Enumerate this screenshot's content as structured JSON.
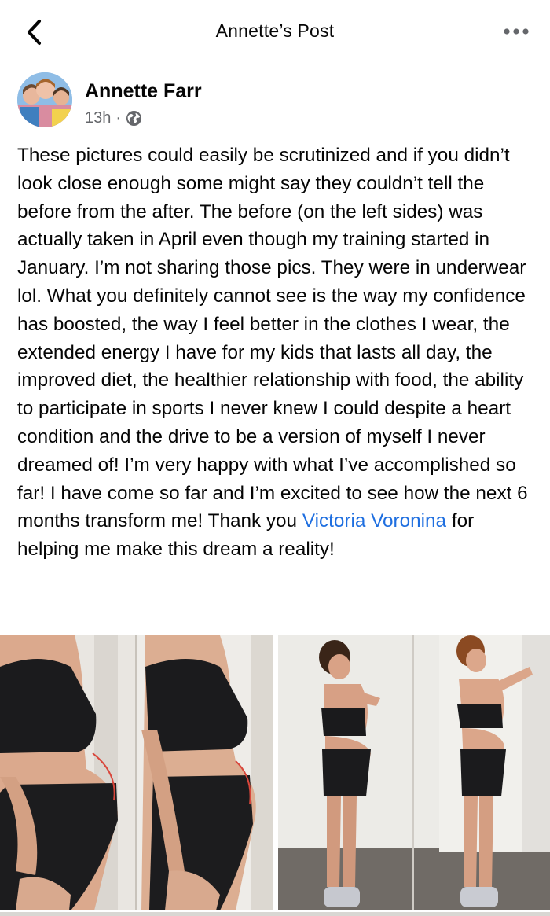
{
  "header": {
    "back_icon": "chevron-left-icon",
    "title": "Annette’s Post",
    "more_icon": "ellipsis-icon"
  },
  "post": {
    "author": "Annette Farr",
    "time": "13h",
    "separator": "·",
    "privacy_icon": "globe-icon",
    "body_before_mention": "These pictures could easily be scrutinized and if you didn’t look close enough some might say they couldn’t tell the before from the after.  The before (on the left sides) was actually taken in April even though my training started in January.  I’m not sharing those pics.  They were in underwear lol.  What you definitely cannot see is the way my confidence has boosted, the way I feel better in the clothes I wear, the extended energy I have for my kids that lasts all day, the improved diet, the healthier relationship with food, the ability to participate in sports I never knew I could despite a heart condition and the drive to be a version of myself I never dreamed of! I’m very happy with what I’ve accomplished so far! I have come so far and I’m excited to see how the next 6 months transform me! Thank you ",
    "mention": "Victoria Voronina",
    "body_after_mention": " for helping me make this dream a reality!"
  },
  "colors": {
    "mention": "#1f6fe0",
    "meta_text": "#65676b",
    "text": "#050505"
  }
}
